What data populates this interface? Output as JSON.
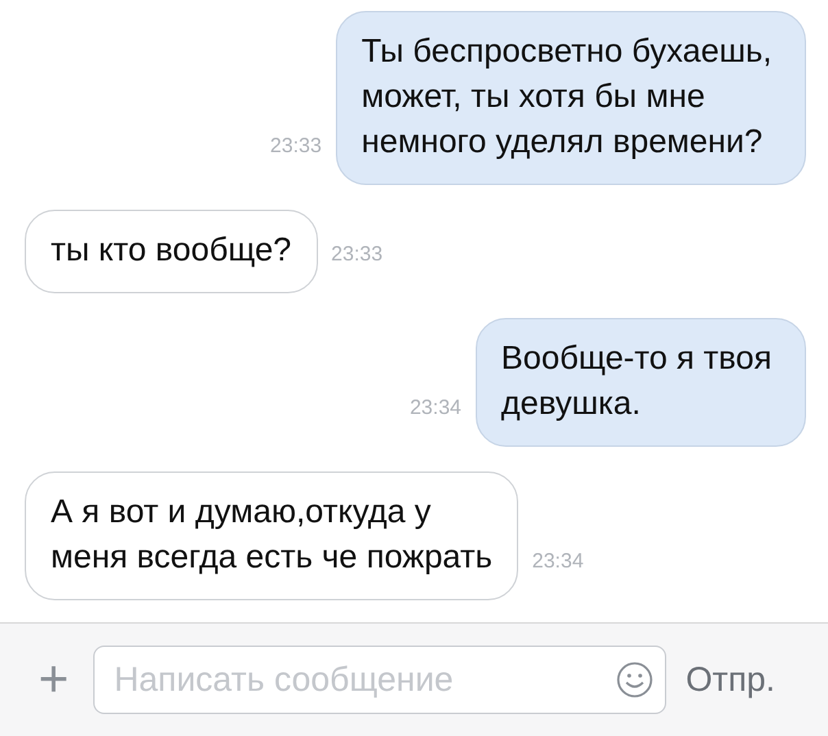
{
  "messages": [
    {
      "kind": "sent",
      "text": "Ты беспросветно бухаешь,\nможет, ты хотя бы мне\nнемного уделял времени?",
      "time": "23:33"
    },
    {
      "kind": "received",
      "text": "ты кто вообще?",
      "time": "23:33"
    },
    {
      "kind": "sent",
      "text": "Вообще-то я твоя\nдевушка.",
      "time": "23:34"
    },
    {
      "kind": "received",
      "text": "А я вот и думаю,откуда у\nменя всегда есть че пожрать",
      "time": "23:34"
    }
  ],
  "composer": {
    "add_button": "+",
    "placeholder": "Написать сообщение",
    "send_button": "Отпр."
  }
}
